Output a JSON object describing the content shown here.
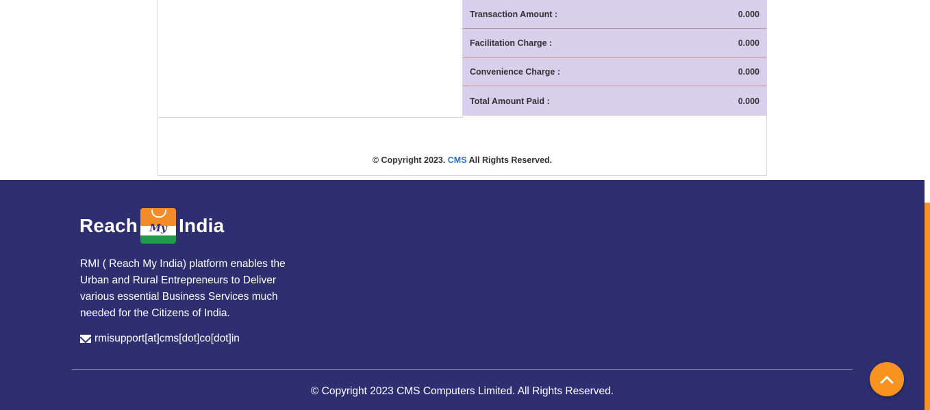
{
  "receipt": {
    "rows": [
      {
        "label": "Transaction Amount :",
        "value": "0.000"
      },
      {
        "label": "Facilitation Charge :",
        "value": "0.000"
      },
      {
        "label": "Convenience Charge :",
        "value": "0.000"
      },
      {
        "label": "Total Amount Paid :",
        "value": "0.000"
      }
    ],
    "copyright_prefix": "© Copyright 2023.",
    "copyright_link": "CMS",
    "copyright_suffix": "All Rights Reserved."
  },
  "footer": {
    "logo": {
      "left_word": "Reach",
      "bag_word": "My",
      "right_word": "India"
    },
    "description": "RMI ( Reach My India) platform enables the Urban and Rural Entrepreneurs to Deliver various essential Business Services much needed for the Citizens of India.",
    "email": "rmisupport[at]cms[dot]co[dot]in",
    "copyright": "© Copyright 2023 CMS Computers Limited. All Rights Reserved."
  },
  "colors": {
    "footer_bg": "#2e2f70",
    "accent_orange": "#f7931e",
    "row_bg": "#d7d0ec",
    "link_blue": "#2a6fcf"
  },
  "icons": {
    "email": "envelope-icon",
    "scroll_top": "chevron-up-icon"
  }
}
